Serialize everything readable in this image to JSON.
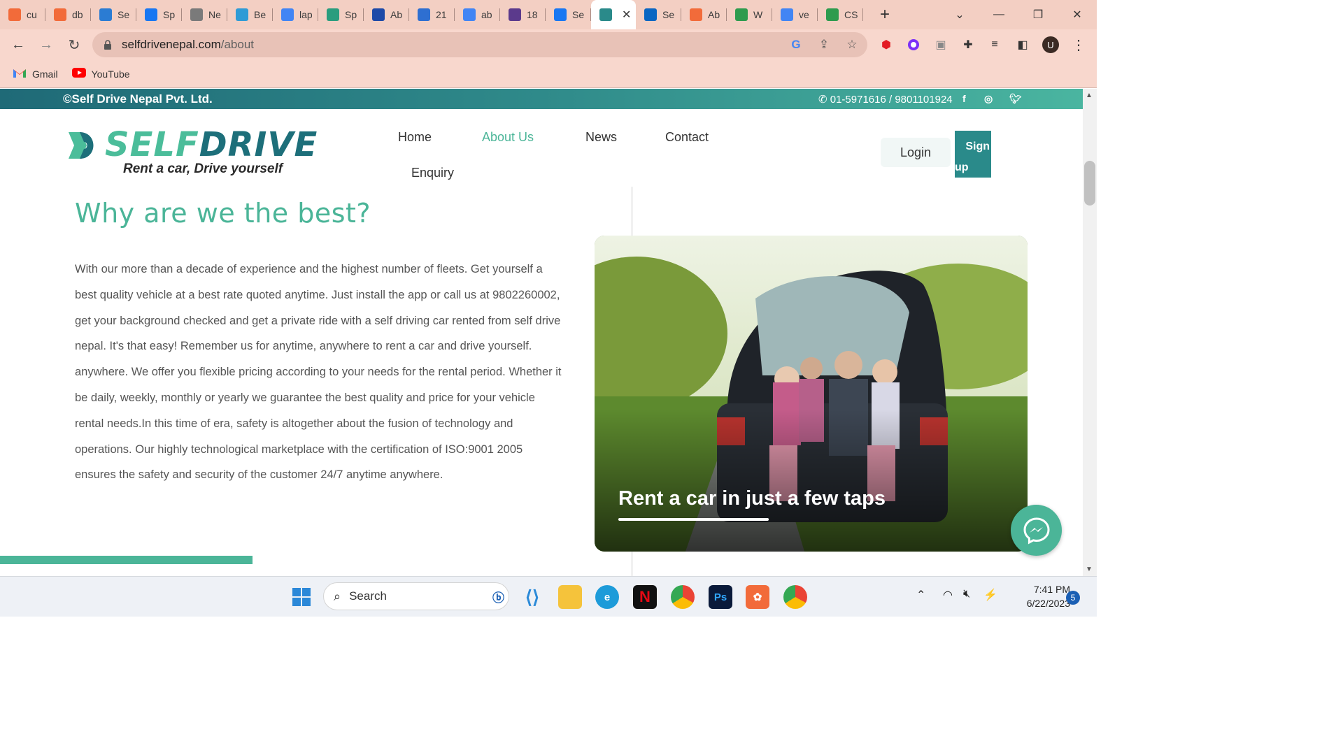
{
  "browser": {
    "tabs": [
      {
        "label": "cu",
        "color": "#f26b3a"
      },
      {
        "label": "db",
        "color": "#f26b3a"
      },
      {
        "label": "Se",
        "color": "#2b7cd3"
      },
      {
        "label": "Sp",
        "color": "#1877f2"
      },
      {
        "label": "Ne",
        "color": "#7a7a7a"
      },
      {
        "label": "Be",
        "color": "#2f9bd6"
      },
      {
        "label": "lap",
        "color": "#4285f4"
      },
      {
        "label": "Sp",
        "color": "#2a9d7e"
      },
      {
        "label": "Ab",
        "color": "#1e4aa8"
      },
      {
        "label": "21",
        "color": "#2e6fd1"
      },
      {
        "label": "ab",
        "color": "#4285f4"
      },
      {
        "label": "18",
        "color": "#5b3a8c"
      },
      {
        "label": "Se",
        "color": "#1877f2"
      },
      {
        "label": "",
        "color": "#2a8a8a"
      },
      {
        "label": "Se",
        "color": "#0a66c2"
      },
      {
        "label": "Ab",
        "color": "#f26b3a"
      },
      {
        "label": "W",
        "color": "#2e9b4e"
      },
      {
        "label": "ve",
        "color": "#4285f4"
      },
      {
        "label": "CS",
        "color": "#2e9b4e"
      }
    ],
    "active_tab_index": 13,
    "url_domain": "selfdrivenepal.com",
    "url_path": "/about",
    "bookmarks": [
      {
        "label": "Gmail",
        "icon": "gmail-icon"
      },
      {
        "label": "YouTube",
        "icon": "youtube-icon"
      }
    ],
    "profile_initial": "U"
  },
  "site": {
    "topbar": {
      "copyright": "©Self Drive Nepal Pvt. Ltd.",
      "phone": "01-5971616 / 9801101924"
    },
    "logo": {
      "word_a": "SELF",
      "word_b": "DRIVE",
      "tagline": "Rent a car, Drive yourself"
    },
    "nav": {
      "home": "Home",
      "about": "About Us",
      "news": "News",
      "contact": "Contact",
      "enquiry": "Enquiry",
      "login": "Login",
      "signup_1": "Sign",
      "signup_2": "up"
    },
    "section": {
      "title": "Why are we the best?",
      "body": "With our more than a decade of experience and the highest number of fleets. Get yourself a best quality vehicle at a best rate quoted anytime. Just install the app or call us at 9802260002, get your background checked and get a private ride with a self driving car rented from self drive nepal. It's that easy! Remember us for anytime, anywhere to rent a car and drive yourself. anywhere. We offer you flexible pricing according to your needs for the rental period. Whether it be daily, weekly, monthly or yearly we guarantee the best quality and price for your vehicle rental needs.In this time of era, safety is altogether about the fusion of technology and operations. Our highly technological marketplace with the certification of ISO:9001 2005 ensures the safety and security of the customer 24/7 anytime anywhere.",
      "image_caption": "Rent a car in just a few taps"
    },
    "colors": {
      "accent": "#4bb598",
      "dark_teal": "#1d6f7a"
    }
  },
  "taskbar": {
    "search_label": "Search",
    "time": "7:41 PM",
    "date": "6/22/2023",
    "notifications": "5"
  }
}
